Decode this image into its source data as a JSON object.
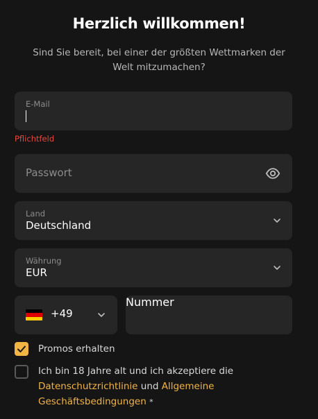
{
  "header": {
    "title": "Herzlich willkommen!",
    "subtitle": "Sind Sie bereit, bei einer der größten Wettmarken der Welt mitzumachen?"
  },
  "email": {
    "label": "E-Mail",
    "value": "",
    "error": "Pflichtfeld"
  },
  "password": {
    "placeholder": "Passwort",
    "icon": "eye-icon"
  },
  "country": {
    "label": "Land",
    "value": "Deutschland"
  },
  "currency": {
    "label": "Währung",
    "value": "EUR"
  },
  "phone": {
    "code": "+49",
    "flag_colors": [
      "#000000",
      "#dd0000",
      "#ffce00"
    ],
    "number_placeholder": "Nummer"
  },
  "promos": {
    "label": "Promos erhalten",
    "checked": true
  },
  "terms": {
    "text_1": "Ich bin 18 Jahre alt und ich akzeptiere die",
    "link_privacy": "Datenschutzrichtlinie",
    "text_2": "und",
    "link_terms_1": "Allgemeine",
    "link_terms_2": "Geschäftsbedingungen",
    "required_mark": "*",
    "checked": false
  },
  "colors": {
    "background": "#151515",
    "field": "#262626",
    "accent": "#f2b544",
    "error": "#e5483d"
  }
}
